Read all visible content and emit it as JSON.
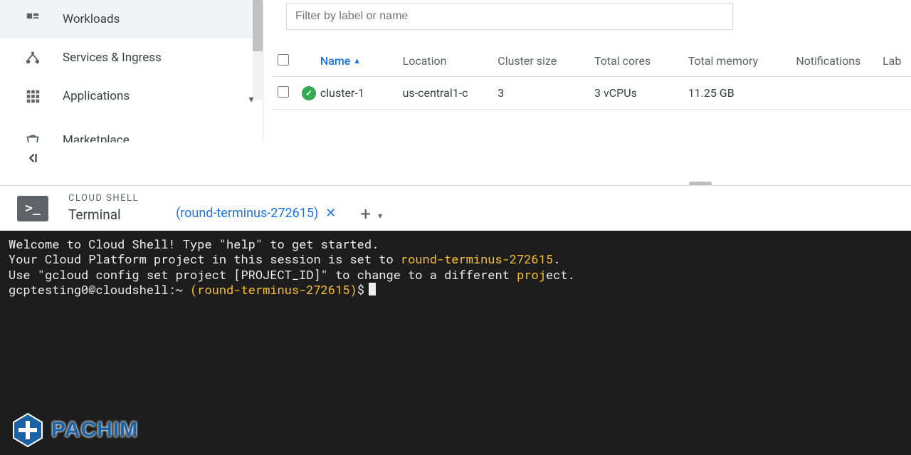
{
  "sidebar": {
    "items": [
      {
        "label": "Workloads"
      },
      {
        "label": "Services & Ingress"
      },
      {
        "label": "Applications"
      },
      {
        "label": "Marketplace"
      }
    ]
  },
  "filter": {
    "placeholder": "Filter by label or name"
  },
  "table": {
    "headers": {
      "name": "Name",
      "location": "Location",
      "cluster_size": "Cluster size",
      "total_cores": "Total cores",
      "total_memory": "Total memory",
      "notifications": "Notifications",
      "labels": "Lab"
    },
    "rows": [
      {
        "status": "ok",
        "name": "cluster-1",
        "location": "us-central1-c",
        "cluster_size": "3",
        "total_cores": "3 vCPUs",
        "total_memory": "11.25 GB",
        "notifications": "",
        "labels": ""
      }
    ]
  },
  "cloud_shell": {
    "label": "CLOUD SHELL",
    "terminal_label": "Terminal",
    "tab": "(round-terminus-272615)",
    "welcome_line": "Welcome to Cloud Shell! Type \"help\" to get started.",
    "project_prefix": "Your Cloud Platform project in this session is set to ",
    "project_id": "round-terminus-272615",
    "hint_prefix": "Use \"gcloud config set project [PROJECT_ID]\" to change to a different ",
    "hint_highlight": "proj",
    "hint_suffix": "ect.",
    "prompt_user": "gcptesting0@cloudshell",
    "prompt_sep": ":",
    "prompt_tilde": "~",
    "prompt_project": "(round-terminus-272615)",
    "prompt_end": "$"
  },
  "brand": {
    "name": "PACHIM"
  },
  "colors": {
    "link_blue": "#1a73e8",
    "status_green": "#34a853",
    "terminal_bg": "#1d1d1d",
    "terminal_yellow": "#fbc02d",
    "brand_blue": "#1b62a5"
  }
}
